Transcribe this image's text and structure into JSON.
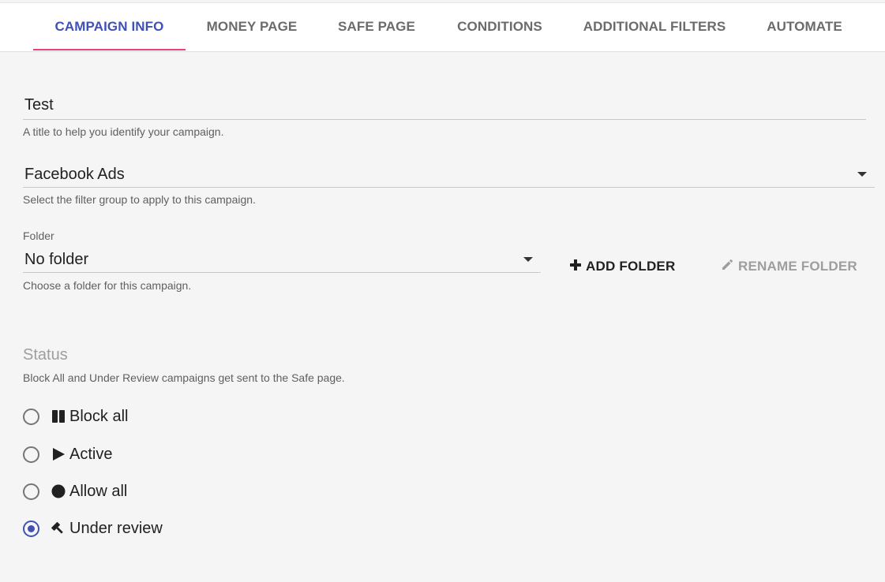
{
  "tabs": [
    {
      "label": "CAMPAIGN INFO",
      "active": true
    },
    {
      "label": "MONEY PAGE",
      "active": false
    },
    {
      "label": "SAFE PAGE",
      "active": false
    },
    {
      "label": "CONDITIONS",
      "active": false
    },
    {
      "label": "ADDITIONAL FILTERS",
      "active": false
    },
    {
      "label": "AUTOMATE",
      "active": false
    }
  ],
  "title_field": {
    "value": "Test",
    "hint": "A title to help you identify your campaign."
  },
  "filter_group": {
    "value": "Facebook Ads",
    "hint": "Select the filter group to apply to this campaign."
  },
  "folder": {
    "label": "Folder",
    "value": "No folder",
    "hint": "Choose a folder for this campaign.",
    "add_button": "ADD FOLDER",
    "rename_button": "RENAME FOLDER"
  },
  "status": {
    "title": "Status",
    "hint": "Block All and Under Review campaigns get sent to the Safe page.",
    "options": [
      {
        "label": "Block all",
        "icon": "pause-icon",
        "checked": false
      },
      {
        "label": "Active",
        "icon": "play-icon",
        "checked": false
      },
      {
        "label": "Allow all",
        "icon": "circle-icon",
        "checked": false
      },
      {
        "label": "Under review",
        "icon": "gavel-icon",
        "checked": true
      }
    ]
  },
  "colors": {
    "accent": "#3f51b5",
    "tab_indicator": "#ec407a",
    "background": "#f5f5f5"
  }
}
